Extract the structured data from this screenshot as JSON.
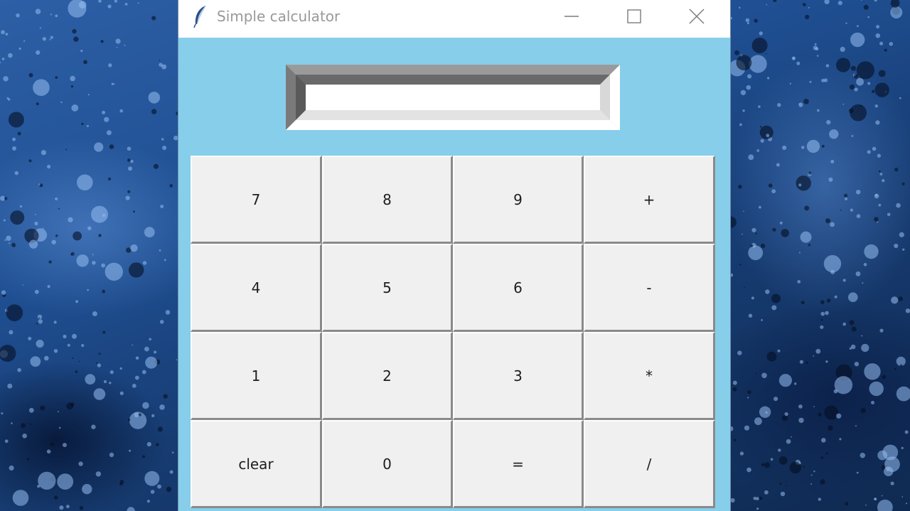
{
  "window": {
    "title": "Simple calculator",
    "background": "#87ceeb",
    "icon": "feather-icon"
  },
  "window_controls": {
    "minimize": "minimize-icon",
    "maximize": "maximize-icon",
    "close": "close-icon"
  },
  "display": {
    "value": "",
    "placeholder": ""
  },
  "keypad": {
    "rows": [
      [
        "7",
        "8",
        "9",
        "+"
      ],
      [
        "4",
        "5",
        "6",
        "-"
      ],
      [
        "1",
        "2",
        "3",
        "*"
      ],
      [
        "clear",
        "0",
        "=",
        "/"
      ]
    ]
  }
}
